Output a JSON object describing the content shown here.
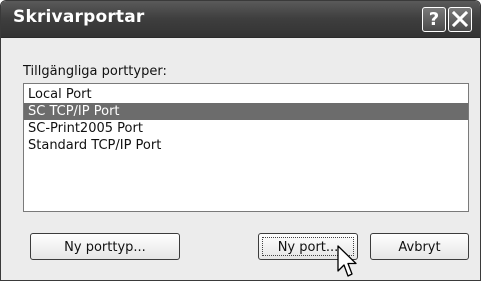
{
  "dialog": {
    "title": "Skrivarportar",
    "help_glyph": "?",
    "available_label": "Tillgängliga porttyper:",
    "port_types": [
      {
        "label": "Local Port",
        "selected": false
      },
      {
        "label": "SC TCP/IP Port",
        "selected": true
      },
      {
        "label": "SC-Print2005 Port",
        "selected": false
      },
      {
        "label": "Standard TCP/IP Port",
        "selected": false
      }
    ],
    "buttons": {
      "new_port_type": "Ny porttyp...",
      "new_port": "Ny port...",
      "cancel": "Avbryt"
    }
  },
  "icons": [
    "help-icon",
    "close-icon",
    "pointer-cursor-icon"
  ],
  "colors": {
    "titlebar": "#3e3e3e",
    "selection": "#6c6c6c",
    "dialog_bg": "#ececec"
  }
}
